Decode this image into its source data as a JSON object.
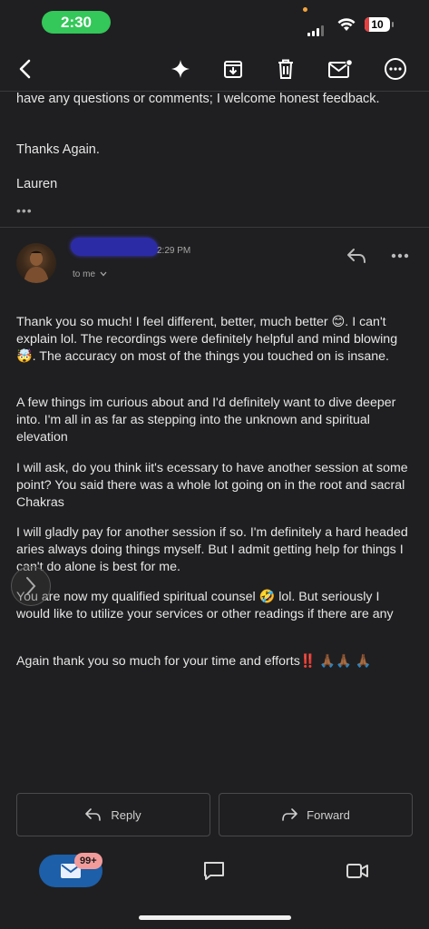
{
  "status_bar": {
    "time": "2:30",
    "battery": "10"
  },
  "toolbar": {
    "back_icon": "back-arrow-icon",
    "icons": [
      "sparkle-icon",
      "archive-icon",
      "trash-icon",
      "mark-unread-icon",
      "more-icon"
    ]
  },
  "previous_message": {
    "lines": [
      "have any questions or comments; I welcome honest feedback.",
      "Thanks Again.",
      "Lauren"
    ],
    "collapsed_indicator": "•••"
  },
  "message": {
    "time": "2:29 PM",
    "to": "to me",
    "paragraphs": [
      "Thank you so much! I feel different, better, much better 😊.  I can't explain lol. The recordings were definitely helpful and mind blowing 🤯. The accuracy on most of the things you touched on is insane.",
      "A few things im curious about and I'd definitely want to dive deeper into. I'm all in as far as stepping into the unknown and spiritual elevation",
      "I will ask, do you think iit's ecessary to have another session at some point? You said there was a whole lot going on in the root and sacral Chakras",
      " I will gladly pay for another session if so. I'm definitely a hard headed aries always doing things myself. But I admit getting help for things I can't do alone is best for me.",
      "You are now my qualified spiritual counsel 🤣 lol. But seriously I would like to utilize your services or other readings if there are any",
      "Again thank you so much for your time and efforts‼️ 🙏🏾🙏🏾 🙏🏾"
    ]
  },
  "actions": {
    "reply": "Reply",
    "forward": "Forward"
  },
  "bottom_nav": {
    "mail_badge": "99+"
  },
  "colors": {
    "background": "#1f1f21",
    "accent": "#1d5fa8",
    "badge": "#f29b9b",
    "time_pill": "#34c759"
  }
}
